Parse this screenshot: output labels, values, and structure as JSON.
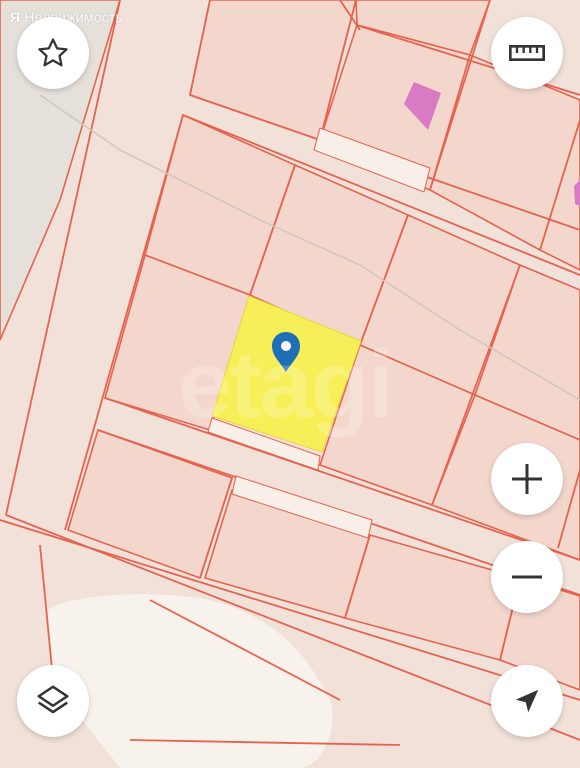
{
  "brand": {
    "logo_glyph": "Я",
    "name": "Недвижимость"
  },
  "watermark": {
    "text": "etagi"
  },
  "map": {
    "colors": {
      "background": "#f1e1d8",
      "parcel_fill": "#f4d7cc",
      "parcel_border": "#e5634f",
      "selected_fill": "#f7ef57",
      "pin": "#1f6fb8",
      "building": "#d97ac4",
      "river": "#f8f2ec"
    },
    "selected_parcel": {
      "marker_icon": "map-pin-icon"
    }
  },
  "controls": {
    "favorite": {
      "icon": "star-icon"
    },
    "ruler": {
      "icon": "ruler-icon"
    },
    "zoom_in": {
      "icon": "plus-icon"
    },
    "zoom_out": {
      "icon": "minus-icon"
    },
    "layers": {
      "icon": "layers-icon"
    },
    "locate": {
      "icon": "navigation-arrow-icon"
    }
  }
}
